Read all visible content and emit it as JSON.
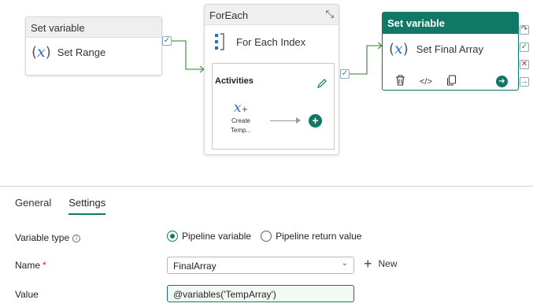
{
  "canvas": {
    "activity_range": {
      "type_label": "Set variable",
      "name": "Set Range",
      "icon": "set-variable-icon"
    },
    "foreach": {
      "type_label": "ForEach",
      "index_label": "For Each Index",
      "activities_title": "Activities",
      "inner_activity": {
        "line1": "Create",
        "line2": "Temp..."
      },
      "icons": [
        "collapse-icon",
        "foreach-icon",
        "edit-pencil-icon",
        "add-icon"
      ]
    },
    "activity_final": {
      "type_label": "Set variable",
      "name": "Set Final Array",
      "toolbar_icons": [
        "delete-icon",
        "code-icon",
        "copy-icon",
        "go-to-icon"
      ]
    },
    "accent_color": "#117865",
    "success_color": "#2e8a2e",
    "fail_color": "#c42b1c"
  },
  "panel": {
    "tabs": [
      {
        "label": "General",
        "active": false
      },
      {
        "label": "Settings",
        "active": true
      }
    ],
    "variable_type": {
      "label": "Variable type",
      "options": [
        {
          "label": "Pipeline variable",
          "selected": true
        },
        {
          "label": "Pipeline return value",
          "selected": false
        }
      ]
    },
    "name": {
      "label": "Name",
      "required_mark": "*",
      "value": "FinalArray",
      "new_label": "New"
    },
    "value": {
      "label": "Value",
      "value": "@variables('TempArray')"
    }
  }
}
